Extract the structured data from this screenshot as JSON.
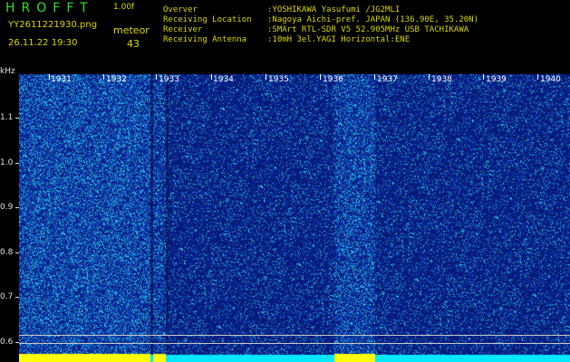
{
  "header": {
    "app_title": "HROFFT",
    "version": "1.00f",
    "filename": "YY2611221930.png",
    "timestamp": "26.11.22 19:30",
    "count_label": "meteor",
    "count_value": "43",
    "observer_key": "Overver",
    "observer_val": ":YOSHIKAWA Yasufumi /JG2MLI",
    "location_key": "Receiving Location",
    "location_val": ":Nagoya Aichi-pref. JAPAN (136.90E, 35.20N)",
    "receiver_key": "Receiver",
    "receiver_val": ":SMArt RTL-SDR V5 52.905MHz USB TACHIKAWA",
    "antenna_key": "Receiving Antenna",
    "antenna_val": ":10mH 3el.YAGI Horizontal:ENE"
  },
  "spectrogram": {
    "y_unit": "kHz",
    "y_labels": [
      "1.1",
      "1.0",
      "0.9",
      "0.8",
      "0.7",
      "0.6"
    ],
    "time_labels": [
      "1931",
      "1932",
      "1933",
      "1934",
      "1935",
      "1936",
      "1937",
      "1938",
      "1939",
      "1940"
    ],
    "colors": {
      "background": "#061a7a",
      "noise_bright": "#2fd0e0",
      "baseline": "#00e8ff",
      "marker": "#ffff00"
    }
  }
}
